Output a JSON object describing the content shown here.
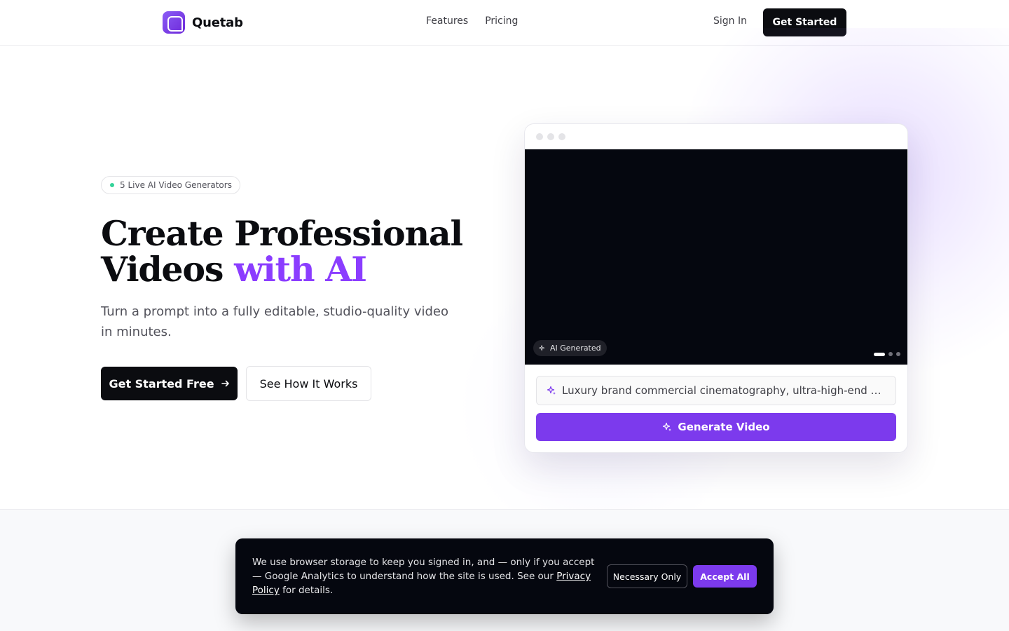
{
  "nav": {
    "brand": "Quetab",
    "links": [
      "Features",
      "Pricing"
    ],
    "sign_in": "Sign In",
    "cta": "Get Started"
  },
  "hero": {
    "badge": "5 Live AI Video Generators",
    "headline_line1": "Create Professional",
    "headline_line2_plain": "Videos ",
    "headline_line2_accent": "with AI",
    "subhead": "Turn a prompt into a fully editable, studio-quality video in minutes.",
    "primary_cta": "Get Started Free",
    "secondary_cta": "See How It Works"
  },
  "demo": {
    "tag": "AI Generated",
    "prompt": "Luxury brand commercial cinematography, ultra-high-end cinematic lighting",
    "generate_label": "Generate Video",
    "carousel": {
      "total": 3,
      "active": 1
    }
  },
  "cookie": {
    "text_before": "We use browser storage to keep you signed in, and — only if you accept — Google Analytics to understand how the site is used. See our ",
    "link": "Privacy Policy",
    "text_after": " for details.",
    "necessary": "Necessary Only",
    "accept": "Accept All"
  },
  "colors": {
    "accent": "#7c3aed",
    "headline_accent": "#8b3dff",
    "dark": "#0b0c10",
    "status_dot": "#34d399"
  }
}
